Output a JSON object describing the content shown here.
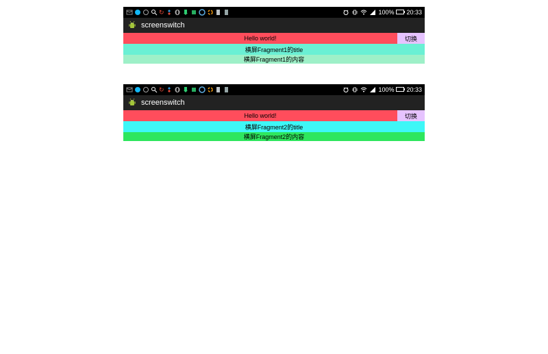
{
  "screens": [
    {
      "status": {
        "battery_percent": "100%",
        "time": "20:33"
      },
      "app_title": "screenswitch",
      "hello_text": "Hello world!",
      "switch_label": "切换",
      "fragment_title": "横屏Fragment1的title",
      "fragment_content": "横屏Fragment1的内容"
    },
    {
      "status": {
        "battery_percent": "100%",
        "time": "20:33"
      },
      "app_title": "screenswitch",
      "hello_text": "Hello world!",
      "switch_label": "切换",
      "fragment_title": "横屏Fragment2的title",
      "fragment_content": "横屏Fragment2的内容"
    }
  ]
}
